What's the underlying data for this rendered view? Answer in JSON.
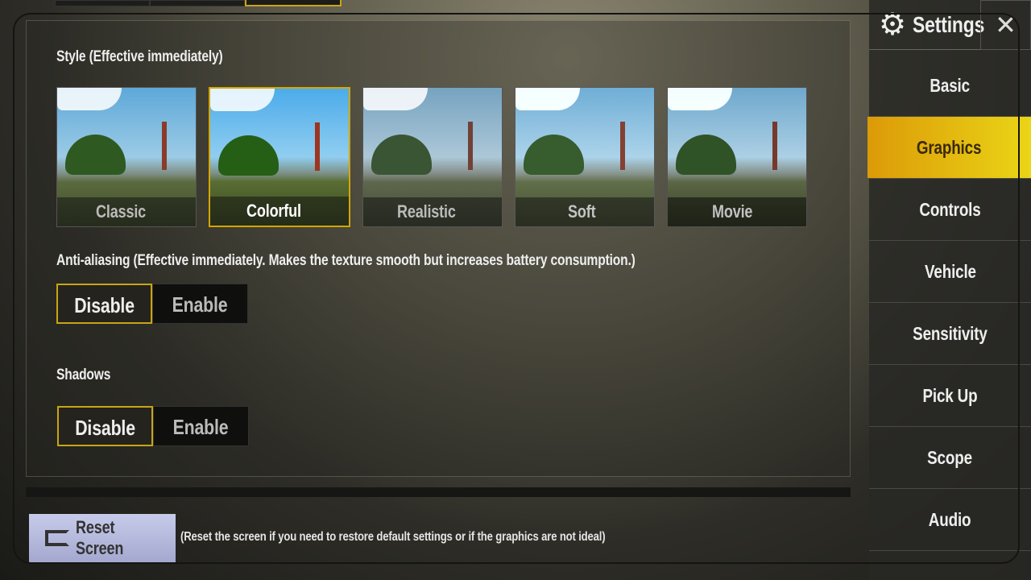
{
  "header": {
    "title": "Settings",
    "gear_icon": "gear-icon",
    "close_icon": "close-icon"
  },
  "sidebar": {
    "items": [
      {
        "label": "Basic",
        "selected": false
      },
      {
        "label": "Graphics",
        "selected": true
      },
      {
        "label": "Controls",
        "selected": false
      },
      {
        "label": "Vehicle",
        "selected": false
      },
      {
        "label": "Sensitivity",
        "selected": false
      },
      {
        "label": "Pick Up",
        "selected": false
      },
      {
        "label": "Scope",
        "selected": false
      },
      {
        "label": "Audio",
        "selected": false
      }
    ]
  },
  "style": {
    "label": "Style (Effective immediately)",
    "options": [
      "Classic",
      "Colorful",
      "Realistic",
      "Soft",
      "Movie"
    ],
    "selected": "Colorful"
  },
  "anti_aliasing": {
    "label": "Anti-aliasing (Effective immediately. Makes the texture smooth but increases battery consumption.)",
    "options": [
      "Disable",
      "Enable"
    ],
    "selected": "Disable"
  },
  "shadows": {
    "label": "Shadows",
    "options": [
      "Disable",
      "Enable"
    ],
    "selected": "Disable"
  },
  "reset": {
    "button": "Reset Screen",
    "note": "(Reset the screen if you need to restore default settings or if the graphics are not ideal)"
  },
  "colors": {
    "accent": "#c9a514",
    "tab_active_start": "#dc9a08",
    "tab_active_end": "#ead516"
  }
}
